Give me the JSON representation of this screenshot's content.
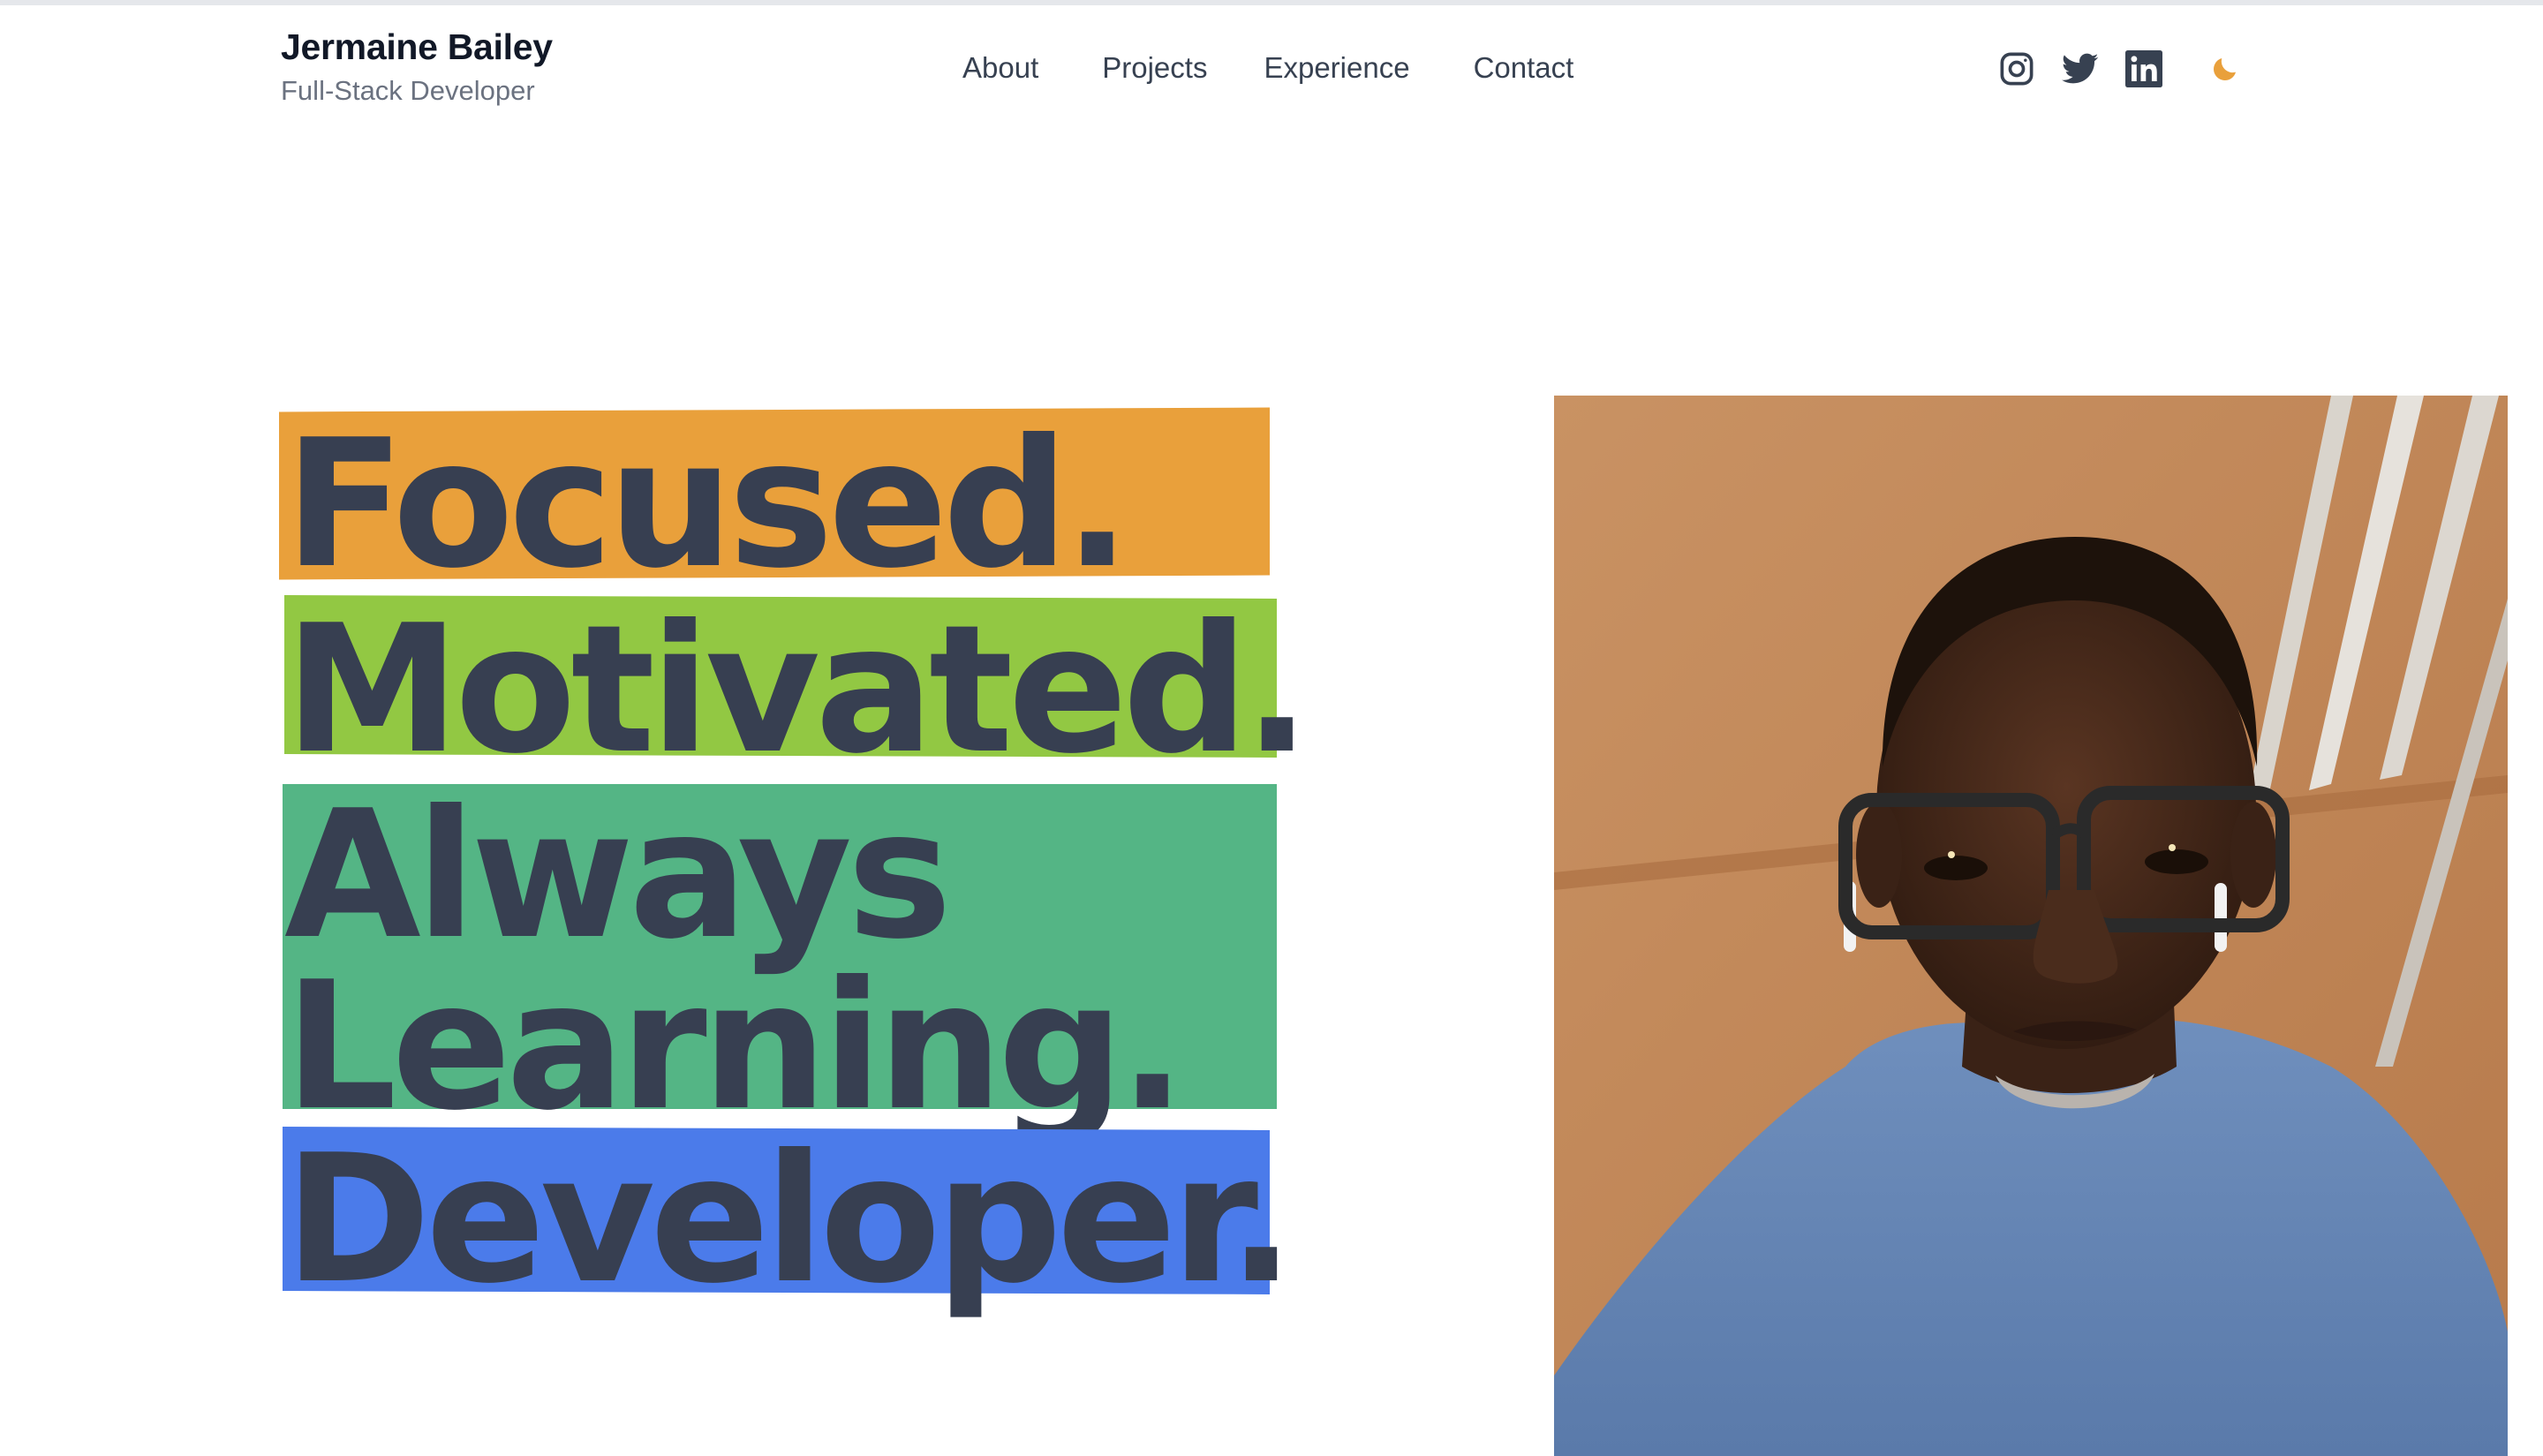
{
  "header": {
    "name": "Jermaine Bailey",
    "title": "Full-Stack Developer"
  },
  "nav": {
    "items": [
      {
        "label": "About"
      },
      {
        "label": "Projects"
      },
      {
        "label": "Experience"
      },
      {
        "label": "Contact"
      }
    ]
  },
  "social": {
    "icons": [
      "instagram-icon",
      "twitter-icon",
      "linkedin-icon",
      "moon-icon"
    ],
    "icon_color": "#374151",
    "theme_toggle_color": "#e9a03b"
  },
  "hero": {
    "words": [
      {
        "text": "Focused.",
        "color": "#e9a03b"
      },
      {
        "text": "Motivated.",
        "color": "#92c843"
      },
      {
        "text": "Always",
        "color": "#54b585"
      },
      {
        "text": "Learning.",
        "color": "#54b585"
      },
      {
        "text": "Developer.",
        "color": "#4b7bea"
      }
    ],
    "text_color": "#373f51"
  },
  "photo": {
    "subject": "portrait photo of a man with glasses in a blue sweater"
  }
}
